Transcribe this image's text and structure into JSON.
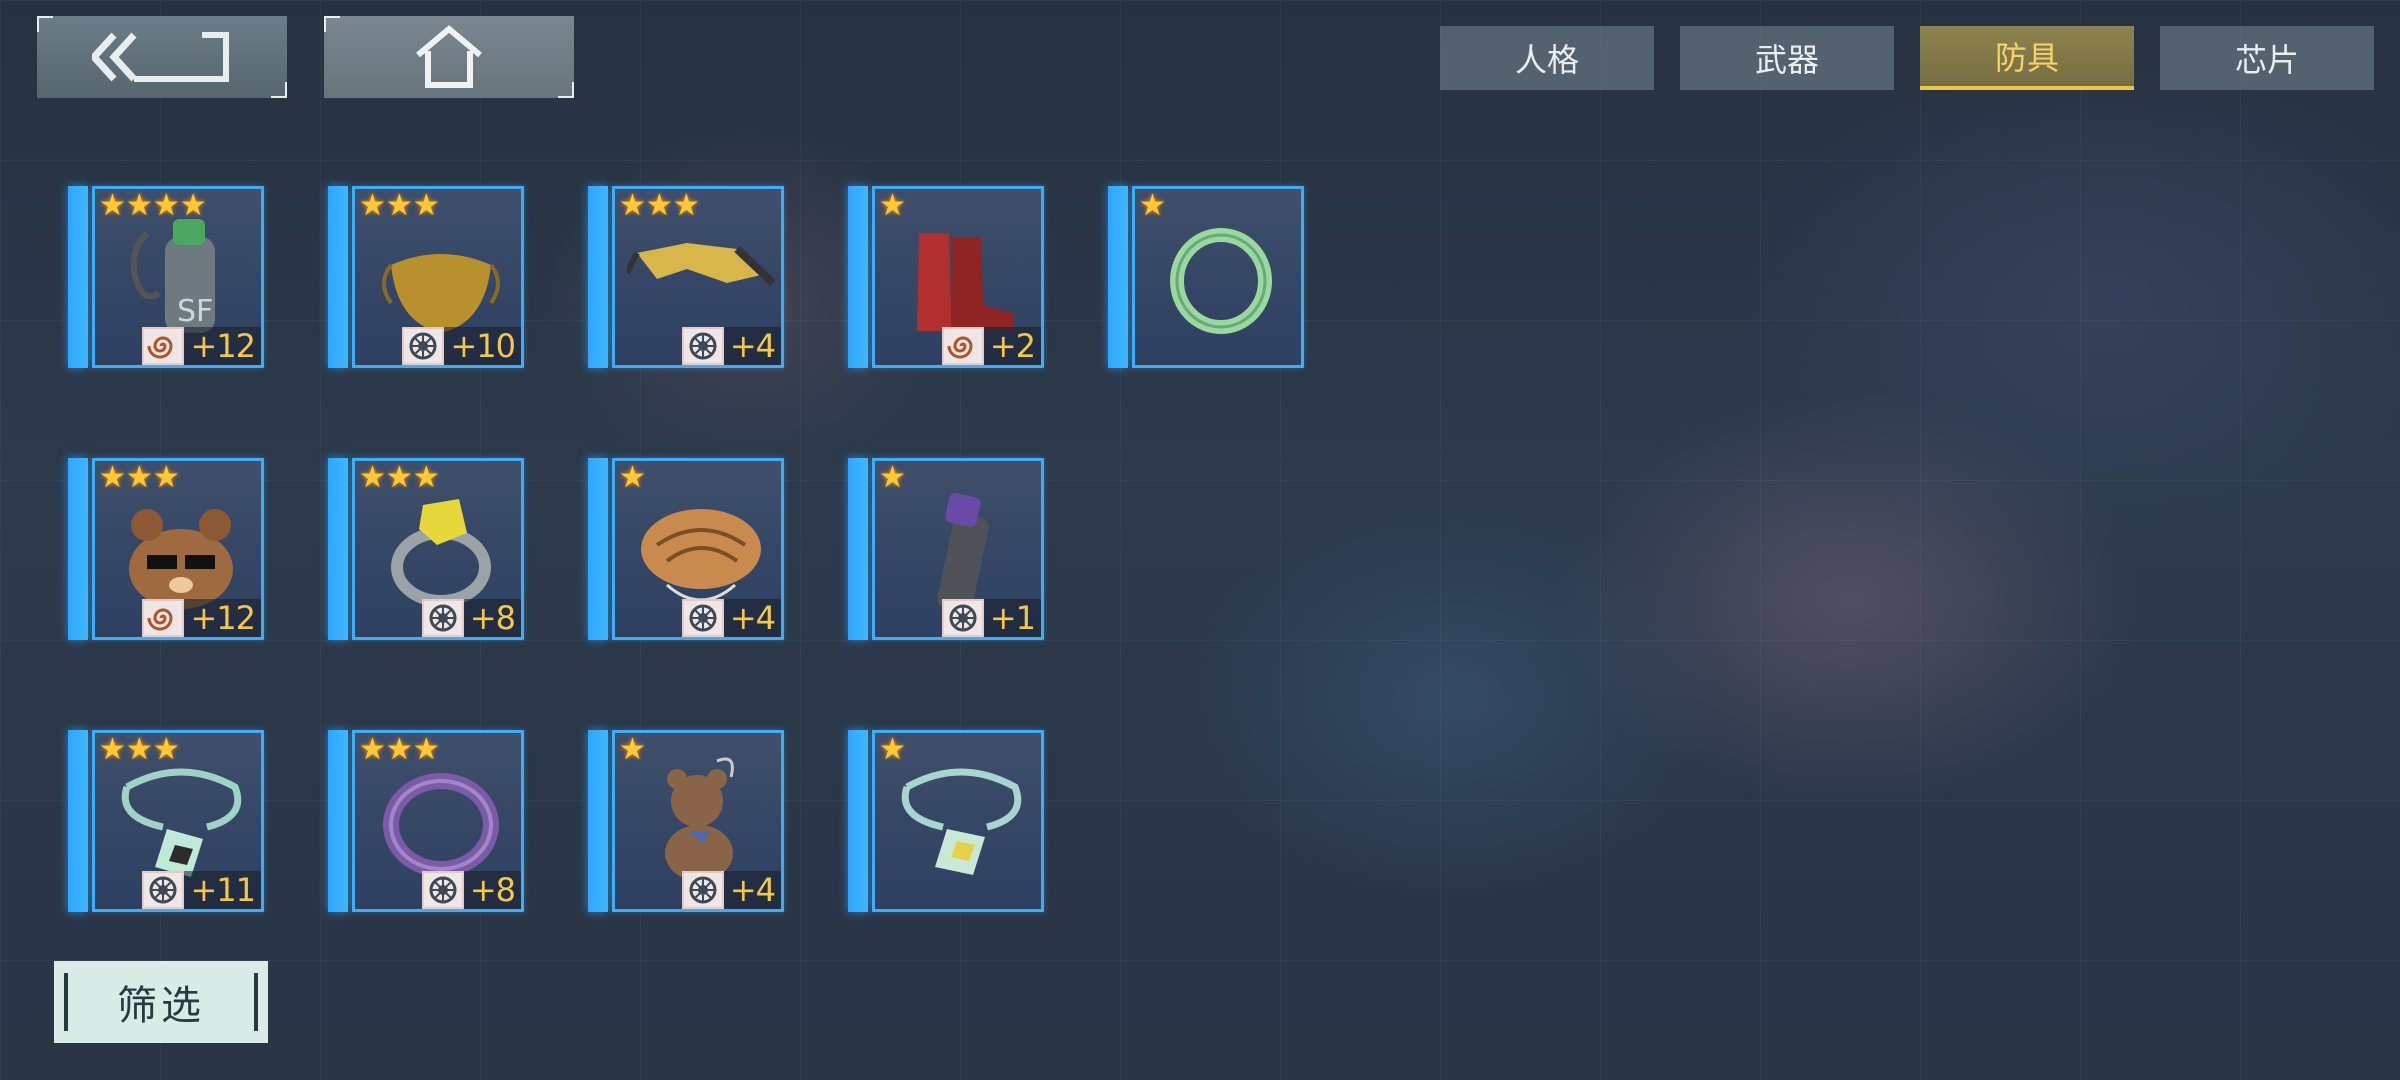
{
  "tabs": [
    {
      "label": "人格",
      "active": false
    },
    {
      "label": "武器",
      "active": false
    },
    {
      "label": "防具",
      "active": true
    },
    {
      "label": "芯片",
      "active": false
    }
  ],
  "items": [
    {
      "name": "bottle",
      "stars": 4,
      "resource": "swirl",
      "level": "+12"
    },
    {
      "name": "mask",
      "stars": 3,
      "resource": "gear",
      "level": "+10"
    },
    {
      "name": "goggles",
      "stars": 3,
      "resource": "gear",
      "level": "+4"
    },
    {
      "name": "boots",
      "stars": 1,
      "resource": "swirl",
      "level": "+2"
    },
    {
      "name": "green-ring",
      "stars": 1,
      "resource": null,
      "level": null
    },
    {
      "name": "bear-backpack",
      "stars": 3,
      "resource": "swirl",
      "level": "+12"
    },
    {
      "name": "gem-ring",
      "stars": 3,
      "resource": "gear",
      "level": "+8"
    },
    {
      "name": "bread",
      "stars": 1,
      "resource": "gear",
      "level": "+4"
    },
    {
      "name": "flask",
      "stars": 1,
      "resource": "gear",
      "level": "+1"
    },
    {
      "name": "green-necklace",
      "stars": 3,
      "resource": "gear",
      "level": "+11"
    },
    {
      "name": "purple-ring",
      "stars": 3,
      "resource": "gear",
      "level": "+8"
    },
    {
      "name": "teddy-bear",
      "stars": 1,
      "resource": "gear",
      "level": "+4"
    },
    {
      "name": "yellow-necklace",
      "stars": 1,
      "resource": null,
      "level": null
    }
  ],
  "filter": {
    "label": "筛选"
  },
  "icons": {
    "back": "back-icon",
    "home": "home-icon"
  },
  "colors": {
    "accent": "#3daef5",
    "star": "#ffc83a",
    "active_tab": "#f5d36b"
  }
}
